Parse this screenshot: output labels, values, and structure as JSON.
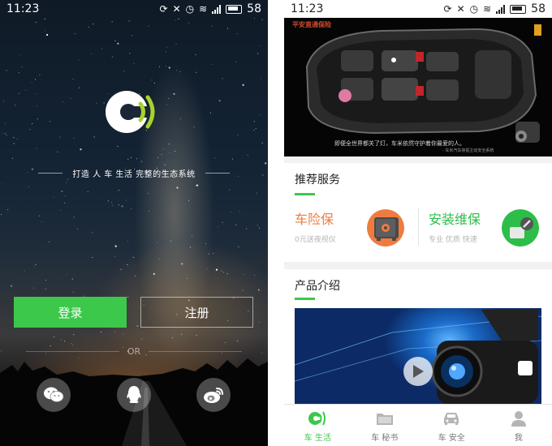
{
  "colors": {
    "accent_green": "#3cc84b",
    "service_orange": "#f07b3f",
    "service_green": "#2dbd49"
  },
  "login_screen": {
    "status_bar": {
      "time": "11:23",
      "battery": "58"
    },
    "slogan": "打造 人 车 生活 完整的生态系统",
    "login_button": "登录",
    "register_button": "注册",
    "or_text": "OR",
    "social": [
      {
        "icon": "wechat-icon"
      },
      {
        "icon": "qq-icon"
      },
      {
        "icon": "weibo-icon"
      }
    ]
  },
  "home_screen": {
    "status_bar": {
      "time": "11:23",
      "battery": "58"
    },
    "banner": {
      "brand": "平安直通保险",
      "caption": "即便全世界都关了灯，车米依然守护着你最爱的人。",
      "sub_caption": "- 车米汽车夜视主动安全系统",
      "dots": 4,
      "active_dot": 0
    },
    "recommended": {
      "title": "推荐服务",
      "services": [
        {
          "name": "车险保",
          "desc": "0元送夜视仪",
          "icon": "safe-box-icon"
        },
        {
          "name": "安装维保",
          "desc": "专业 优质 快速",
          "icon": "wrench-icon"
        }
      ]
    },
    "products": {
      "title": "产品介绍",
      "video_icon": "play-icon"
    },
    "tabs": [
      {
        "label": "车 生活",
        "icon": "brand-logo-icon",
        "active": true
      },
      {
        "label": "车 秘书",
        "icon": "folder-icon",
        "active": false
      },
      {
        "label": "车 安全",
        "icon": "car-icon",
        "active": false
      },
      {
        "label": "我",
        "icon": "person-icon",
        "active": false
      }
    ]
  }
}
